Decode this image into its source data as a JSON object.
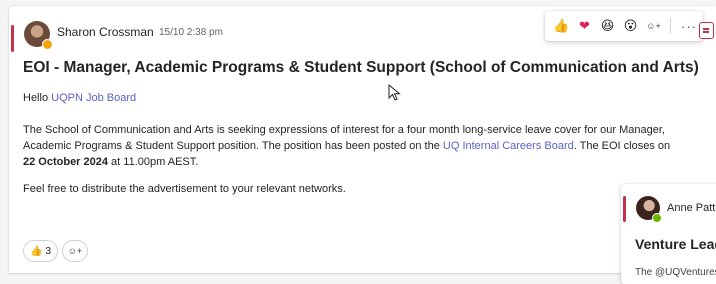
{
  "post": {
    "author": "Sharon Crossman",
    "timestamp": "15/10 2:38 pm",
    "subject": "EOI - Manager, Academic Programs & Student Support (School of Communication and Arts)",
    "greeting_prefix": "Hello ",
    "greeting_mention": "UQPN Job Board",
    "body_part1": "The School of Communication and Arts is seeking expressions of interest for a four month long-service leave cover for our Manager, Academic Programs & Student Support position. The position has been posted on the ",
    "body_link": "UQ Internal Careers Board",
    "body_part2": ". The EOI closes on ",
    "body_bold": "22 October 2024",
    "body_part3": " at 11.00pm AEST.",
    "closing": "Feel free to distribute the advertisement to your relevant networks.",
    "reactions": [
      {
        "icon": "thumbs-up-icon",
        "glyph": "👍",
        "count": "3"
      }
    ],
    "add_reaction_glyph": "☺+"
  },
  "toolbar": {
    "reactions": [
      {
        "name": "like",
        "glyph": "👍"
      },
      {
        "name": "heart",
        "glyph": "❤"
      },
      {
        "name": "laugh",
        "glyph": "😆"
      },
      {
        "name": "surprised",
        "glyph": "😮"
      },
      {
        "name": "add-reaction",
        "glyph": "☺+"
      }
    ],
    "more_glyph": "···"
  },
  "next_post": {
    "author": "Anne Patte",
    "subject": "Venture Lead",
    "preview": "The @UQVentures"
  },
  "colors": {
    "accent": "#c4314b",
    "link": "#5b5fc7",
    "presence_away": "#f8a50a",
    "presence_available": "#6bb700"
  }
}
